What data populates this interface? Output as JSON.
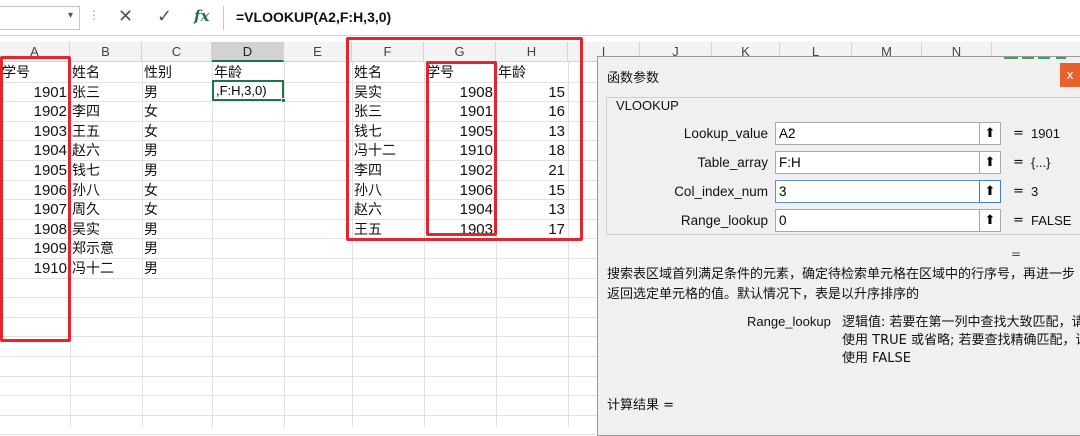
{
  "formula_bar": {
    "name_box": "",
    "dots": "⋮",
    "cancel_icon": "✕",
    "enter_icon": "✓",
    "fx": "fx",
    "formula": "=VLOOKUP(A2,F:H,3,0)"
  },
  "columns": [
    "A",
    "B",
    "C",
    "D",
    "E",
    "F",
    "G",
    "H",
    "I",
    "J",
    "K",
    "L",
    "M",
    "N"
  ],
  "sheet": {
    "left_table": {
      "headers": [
        "学号",
        "姓名",
        "性别",
        "年龄"
      ],
      "rows": [
        [
          "1901",
          "张三",
          "男"
        ],
        [
          "1902",
          "李四",
          "女"
        ],
        [
          "1903",
          "王五",
          "女"
        ],
        [
          "1904",
          "赵六",
          "男"
        ],
        [
          "1905",
          "钱七",
          "男"
        ],
        [
          "1906",
          "孙八",
          "女"
        ],
        [
          "1907",
          "周久",
          "女"
        ],
        [
          "1908",
          "吴实",
          "男"
        ],
        [
          "1909",
          "郑示意",
          "男"
        ],
        [
          "1910",
          "冯十二",
          "男"
        ]
      ]
    },
    "active_cell_text": ",F:H,3,0)",
    "right_table": {
      "headers": [
        "姓名",
        "学号",
        "年龄"
      ],
      "rows": [
        [
          "吴实",
          "1908",
          "15"
        ],
        [
          "张三",
          "1901",
          "16"
        ],
        [
          "钱七",
          "1905",
          "13"
        ],
        [
          "冯十二",
          "1910",
          "18"
        ],
        [
          "李四",
          "1902",
          "21"
        ],
        [
          "孙八",
          "1906",
          "15"
        ],
        [
          "赵六",
          "1904",
          "13"
        ],
        [
          "王五",
          "1903",
          "17"
        ]
      ]
    }
  },
  "dialog": {
    "title": "函数参数",
    "close_icon": "x",
    "function_name": "VLOOKUP",
    "args": [
      {
        "label": "Lookup_value",
        "value": "A2",
        "result": "1901"
      },
      {
        "label": "Table_array",
        "value": "F:H",
        "result": "{...}"
      },
      {
        "label": "Col_index_num",
        "value": "3",
        "result": "3"
      },
      {
        "label": "Range_lookup",
        "value": "0",
        "result": "FALSE"
      }
    ],
    "eq": "=",
    "function_eq": "=",
    "description": "搜索表区域首列满足条件的元素，确定待检索单元格在区域中的行序号，再进一步返回选定单元格的值。默认情况下，表是以升序排序的",
    "arg_help_name": "Range_lookup",
    "arg_help_desc": "逻辑值: 若要在第一列中查找大致匹配，请使用 TRUE 或省略; 若要查找精确匹配，请使用 FALSE",
    "calc_result": "计算结果 ="
  },
  "colors": {
    "highlight_red": "#e3262b",
    "excel_green": "#217346"
  }
}
